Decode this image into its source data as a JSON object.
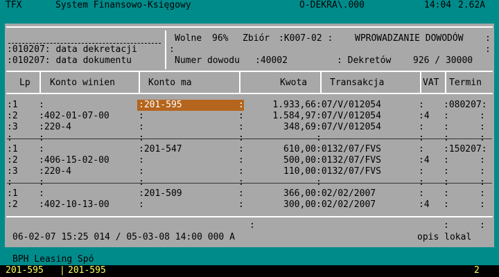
{
  "topbar": {
    "app": "TFX",
    "title": "System Finansowo-Księgowy",
    "path": "O-DEKRA\\.000",
    "time": "14:04",
    "version": "2.62A"
  },
  "header": {
    "line1": ":010207: data dekretacji",
    "line2": ":010207: data dokumentu",
    "wolne_label": "Wolne",
    "wolne_value": "96%",
    "zbior_label": "Zbiór",
    "zbior_value": ":K007-02 :",
    "mode": "WPROWADZANIE DOWODÓW",
    "numer_label": "Numer dowodu",
    "numer_value": ":40002",
    "dekretow_label": ": Dekretów",
    "dekretow_value": "926 / 30000"
  },
  "columns": [
    "Lp",
    "Konto winien",
    "Konto ma",
    "Kwota",
    "Transakcja",
    "VAT",
    "Termin"
  ],
  "rows": [
    {
      "lp": ":1",
      "winien": ":",
      "ma": ":201-595",
      "kwota": "1.933,66",
      "trans": ":07/V/012054",
      "vat": ":",
      "termin": ":080207:"
    },
    {
      "lp": ":2",
      "winien": ":402-01-07-00",
      "ma": ":",
      "kwota": "1.584,97",
      "trans": ":07/V/012054",
      "vat": ":4",
      "termin": ":"
    },
    {
      "lp": ":3",
      "winien": ":220-4",
      "ma": ":",
      "kwota": "348,69",
      "trans": ":07/V/012054",
      "vat": ":",
      "termin": ":"
    },
    {
      "lp": ":1",
      "winien": ":",
      "ma": ":201-547",
      "kwota": "610,00",
      "trans": ":0132/07/FVS",
      "vat": ":",
      "termin": ":150207:"
    },
    {
      "lp": ":2",
      "winien": ":406-15-02-00",
      "ma": ":",
      "kwota": "500,00",
      "trans": ":0132/07/FVS",
      "vat": ":4",
      "termin": ":"
    },
    {
      "lp": ":3",
      "winien": ":220-4",
      "ma": ":",
      "kwota": "110,00",
      "trans": ":0132/07/FVS",
      "vat": ":",
      "termin": ":"
    },
    {
      "lp": ":1",
      "winien": ":",
      "ma": ":201-509",
      "kwota": "366,00",
      "trans": ":02/02/2007",
      "vat": ":",
      "termin": ":"
    },
    {
      "lp": ":2",
      "winien": ":402-10-13-00",
      "ma": ":",
      "kwota": "300,00",
      "trans": ":02/02/2007",
      "vat": ":4",
      "termin": ":"
    }
  ],
  "footer": {
    "info": "06-02-07 15:25 014 / 05-03-08 14:00 000 A",
    "opis": "opis lokal"
  },
  "status": {
    "company": "BPH Leasing Spó"
  },
  "bottom": {
    "left": "201-595",
    "right": "201-595",
    "num": "2"
  }
}
